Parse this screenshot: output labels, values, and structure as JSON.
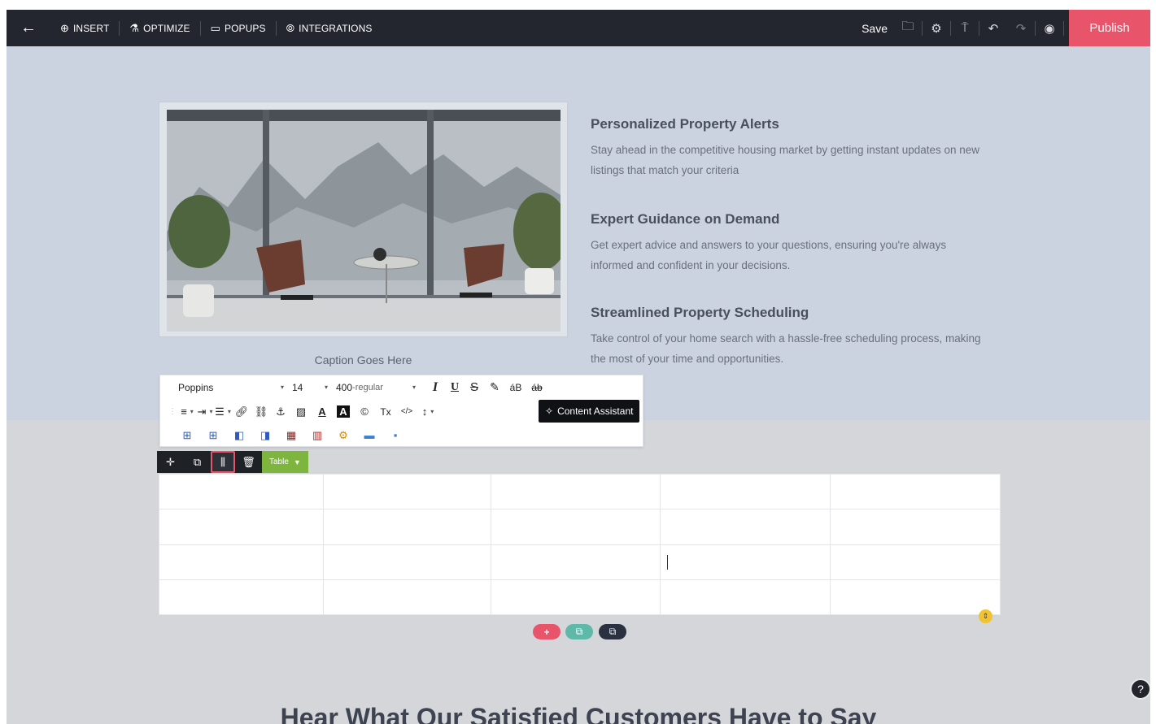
{
  "topbar": {
    "back_icon": "arrow-left-icon",
    "nav": [
      {
        "label": "INSERT",
        "icon": "plus-circle-icon"
      },
      {
        "label": "OPTIMIZE",
        "icon": "flask-icon"
      },
      {
        "label": "POPUPS",
        "icon": "popup-icon"
      },
      {
        "label": "INTEGRATIONS",
        "icon": "integrations-icon"
      }
    ],
    "save_label": "Save",
    "publish_label": "Publish",
    "colors": {
      "bar": "#23262e",
      "publish": "#e8546a"
    }
  },
  "image_block": {
    "caption": "Caption Goes Here"
  },
  "features": [
    {
      "title": "Personalized Property Alerts",
      "text": "Stay ahead in the competitive housing market by getting instant updates on new listings that match your criteria"
    },
    {
      "title": "Expert Guidance on Demand",
      "text": "Get expert advice and answers to your questions, ensuring you're always informed and confident in your decisions."
    },
    {
      "title": "Streamlined Property Scheduling",
      "text": "Take control of your home search with a hassle-free scheduling process, making the most of your time and opportunities."
    }
  ],
  "editor_toolbar": {
    "font_family": "Poppins",
    "font_size": "14",
    "font_weight": "400",
    "font_weight_style": "-regular",
    "content_assistant_label": "Content Assistant"
  },
  "element_bar": {
    "type_label": "Table"
  },
  "table": {
    "rows": 4,
    "columns": 5
  },
  "section_heading": "Hear What Our Satisfied Customers Have to Say",
  "help_icon": "question-icon"
}
